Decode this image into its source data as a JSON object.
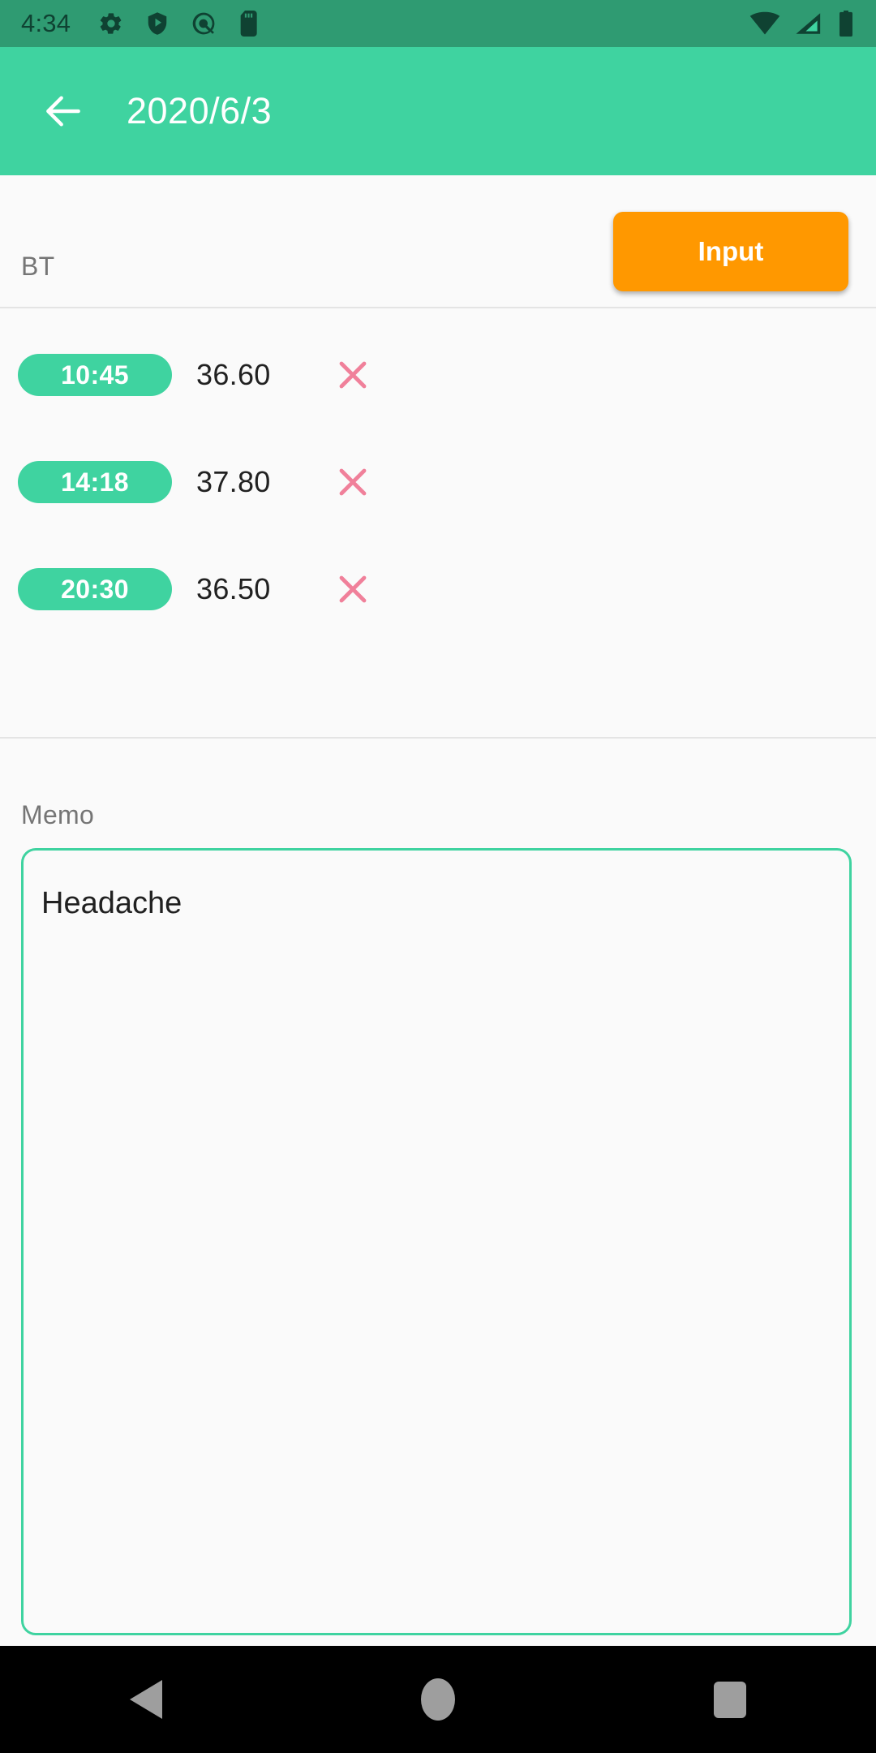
{
  "status_bar": {
    "time": "4:34",
    "left_icons": [
      "gear-icon",
      "shield-play-icon",
      "android-q-icon",
      "sd-card-icon"
    ],
    "right_icons": [
      "wifi-icon",
      "cell-signal-icon",
      "battery-icon"
    ],
    "background_color": "#2F9B72",
    "icon_color": "#0F4232"
  },
  "app_bar": {
    "title": "2020/6/3",
    "back_icon": "arrow-left-icon",
    "background_color": "#3FD3A0",
    "text_color": "#FFFFFF"
  },
  "bt_section": {
    "label": "BT",
    "input_button_label": "Input",
    "input_button_color": "#FF9800"
  },
  "readings": [
    {
      "time": "10:45",
      "value": "36.60",
      "delete_icon": "close-x-icon"
    },
    {
      "time": "14:18",
      "value": "37.80",
      "delete_icon": "close-x-icon"
    },
    {
      "time": "20:30",
      "value": "36.50",
      "delete_icon": "close-x-icon"
    }
  ],
  "memo": {
    "label": "Memo",
    "value": "Headache",
    "placeholder": "",
    "border_color": "#3FD3A0"
  },
  "nav_bar": {
    "back_icon": "nav-back-triangle-icon",
    "home_icon": "nav-home-circle-icon",
    "recents_icon": "nav-recents-square-icon",
    "background_color": "#000000",
    "icon_color": "#9E9E9E"
  },
  "theme": {
    "accent_green": "#3FD3A0",
    "status_green": "#2F9B72",
    "orange": "#FF9800",
    "pink_delete": "#F0809A",
    "page_background": "#FAFAFA"
  }
}
